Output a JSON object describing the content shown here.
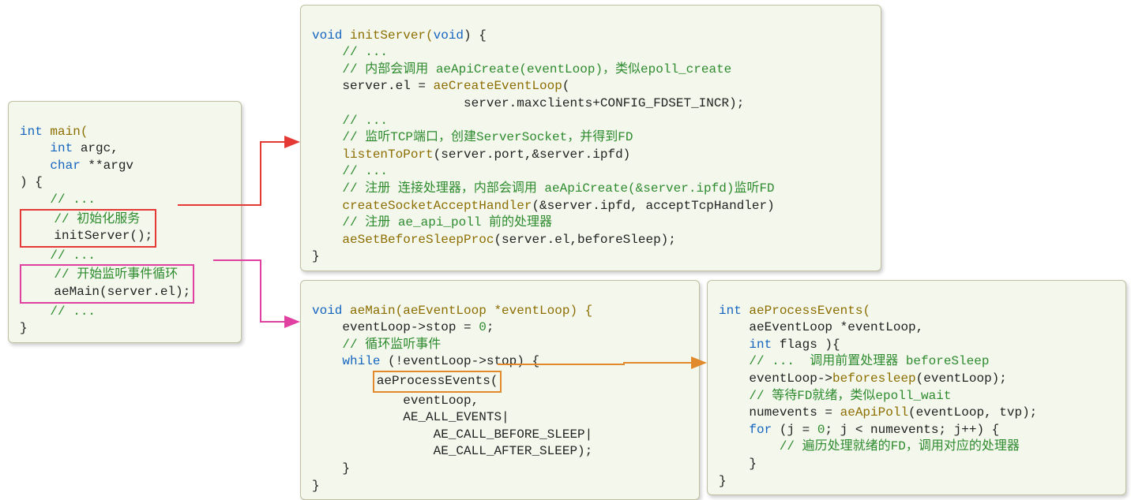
{
  "boxes": {
    "main": {
      "sig1": "int",
      "sig2": " main(",
      "arg1a": "    int",
      "arg1b": " argc,",
      "arg2a": "    char",
      "arg2b": " **argv",
      "sig3": ") {",
      "c1": "    // ...",
      "c2": "    // 初始化服务",
      "call1": "    initServer();",
      "c3": "    // ...",
      "c4": "    // 开始监听事件循环",
      "call2": "    aeMain(server.el);",
      "c5": "    // ...",
      "close": "}"
    },
    "initServer": {
      "sig1": "void",
      "sig2": " initServer(",
      "sig3": "void",
      "sig4": ") {",
      "c1": "    // ...",
      "c2": "    // 内部会调用 aeApiCreate(eventLoop)，类似epoll_create",
      "l3a": "    server.el = ",
      "l3b": "aeCreateEventLoop",
      "l3c": "(",
      "l4": "                    server.maxclients+CONFIG_FDSET_INCR);",
      "c5": "    // ...",
      "c6": "    // 监听TCP端口，创建ServerSocket，并得到FD",
      "l7a": "    ",
      "l7b": "listenToPort",
      "l7c": "(server.port,&server.ipfd)",
      "c8": "    // ...",
      "c9": "    // 注册 连接处理器，内部会调用 aeApiCreate(&server.ipfd)监听FD",
      "l10a": "    ",
      "l10b": "createSocketAcceptHandler",
      "l10c": "(&server.ipfd, acceptTcpHandler)",
      "c11": "    // 注册 ae_api_poll 前的处理器",
      "l12a": "    ",
      "l12b": "aeSetBeforeSleepProc",
      "l12c": "(server.el,beforeSleep);",
      "close": "}"
    },
    "aeMain": {
      "sig1": "void",
      "sig2": " aeMain(aeEventLoop *eventLoop) {",
      "l1": "    eventLoop->stop = ",
      "l1n": "0",
      "l1e": ";",
      "c2": "    // 循环监听事件",
      "l3a": "    ",
      "l3b": "while",
      "l3c": " (!eventLoop->stop) {",
      "l4a": "        ",
      "l4b": "aeProcessEvents(",
      "l5": "            eventLoop,",
      "l6": "            AE_ALL_EVENTS|",
      "l7": "                AE_CALL_BEFORE_SLEEP|",
      "l8": "                AE_CALL_AFTER_SLEEP);",
      "l9": "    }",
      "close": "}"
    },
    "aeProcess": {
      "sig1": "int",
      "sig2": " aeProcessEvents(",
      "l1": "    aeEventLoop *eventLoop,",
      "l2a": "    ",
      "l2b": "int",
      "l2c": " flags ){",
      "c3": "    // ...  调用前置处理器 beforeSleep",
      "l4a": "    eventLoop->",
      "l4b": "beforesleep",
      "l4c": "(eventLoop);",
      "c5": "    // 等待FD就绪，类似epoll_wait",
      "l6a": "    numevents = ",
      "l6b": "aeApiPoll",
      "l6c": "(eventLoop, tvp);",
      "l7a": "    ",
      "l7b": "for",
      "l7c": " (j = ",
      "l7d": "0",
      "l7e": "; j < numevents; j++) {",
      "c8": "        // 遍历处理就绪的FD，调用对应的处理器",
      "l9": "    }",
      "close": "}"
    }
  }
}
